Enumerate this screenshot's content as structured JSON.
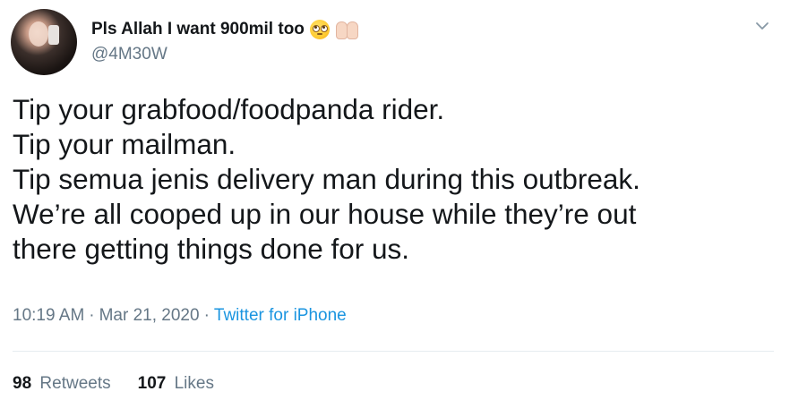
{
  "author": {
    "display_name": "Pls Allah I want 900mil too",
    "handle": "@4M30W",
    "name_emojis": [
      "pleading-face-emoji",
      "folded-hands-emoji"
    ]
  },
  "tweet": {
    "lines": [
      "Tip your grabfood/foodpanda rider.",
      "Tip your mailman.",
      "Tip semua jenis delivery man during this outbreak.",
      "We’re all cooped up in our house while they’re out",
      "there getting things done for us."
    ]
  },
  "meta": {
    "time": "10:19 AM",
    "separator": "·",
    "date": "Mar 21, 2020",
    "source": "Twitter for iPhone"
  },
  "stats": {
    "retweets_count": "98",
    "retweets_label": "Retweets",
    "likes_count": "107",
    "likes_label": "Likes"
  },
  "colors": {
    "text": "#14171a",
    "secondary": "#657786",
    "link": "#1b95e0",
    "divider": "#e6ecf0"
  },
  "icons": {
    "menu": "chevron-down-icon"
  }
}
